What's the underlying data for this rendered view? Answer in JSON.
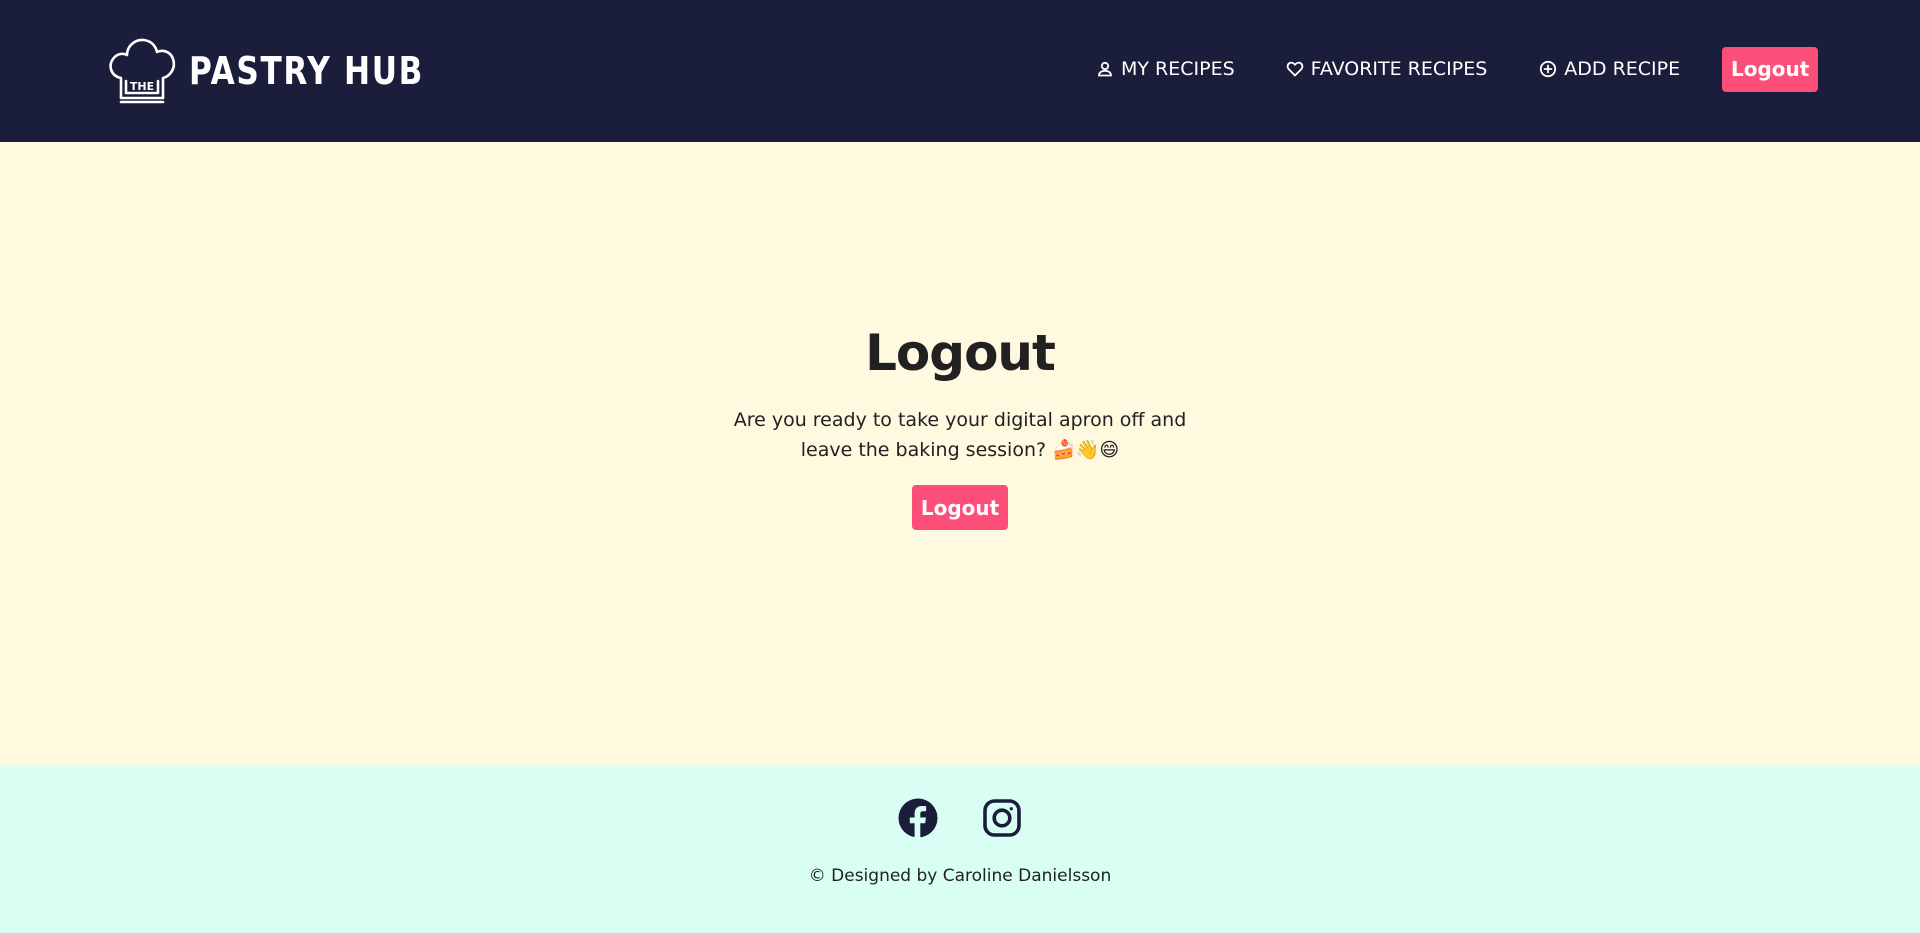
{
  "header": {
    "logo_small": "THE",
    "logo_text": "PASTRY HUB",
    "nav": {
      "my_recipes": "MY RECIPES",
      "favorite_recipes": "FAVORITE RECIPES",
      "add_recipe": "ADD RECIPE",
      "logout": "Logout"
    }
  },
  "main": {
    "title": "Logout",
    "message": "Are you ready to take your digital apron off and leave the baking session? 🍰👋😄",
    "button": "Logout"
  },
  "footer": {
    "social": [
      "facebook-icon",
      "instagram-icon"
    ],
    "copyright": "© Designed by Caroline Danielsson"
  },
  "colors": {
    "header_bg": "#1b1e3b",
    "main_bg": "#fff9df",
    "footer_bg": "#d9fff5",
    "accent": "#fb4f79",
    "text": "#212121"
  }
}
